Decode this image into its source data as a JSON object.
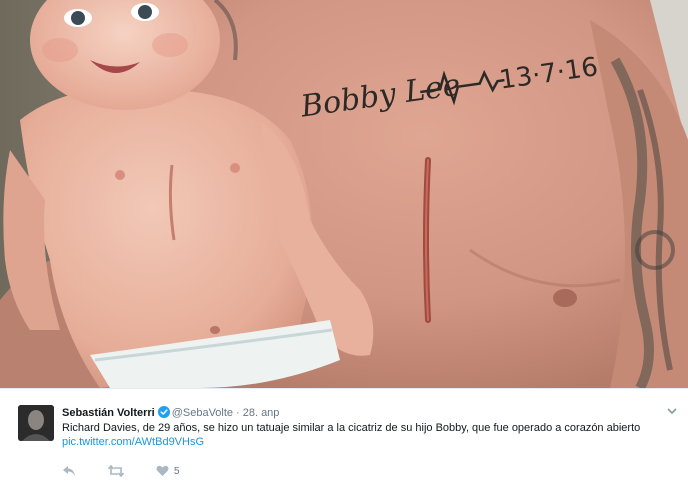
{
  "tweet": {
    "author_name": "Sebastián Volterri",
    "handle": "@SebaVolte",
    "separator": "·",
    "date": "28. anp",
    "text": "Richard Davies, de 29 años, se hizo un tatuaje similar a la cicatriz de su hijo Bobby, que fue operado a corazón abierto",
    "link": "pic.twitter.com/AWtBd9VHsG",
    "like_count": "5",
    "verified_icon": "verified-badge-icon",
    "verified_color": "#1da1f2",
    "link_color": "#1b95e0"
  },
  "photo": {
    "tattoo_text": "Bobby Lee",
    "tattoo_date": "13·7·16"
  },
  "actions": [
    {
      "icon": "reply-icon"
    },
    {
      "icon": "retweet-icon"
    },
    {
      "icon": "heart-icon"
    }
  ]
}
